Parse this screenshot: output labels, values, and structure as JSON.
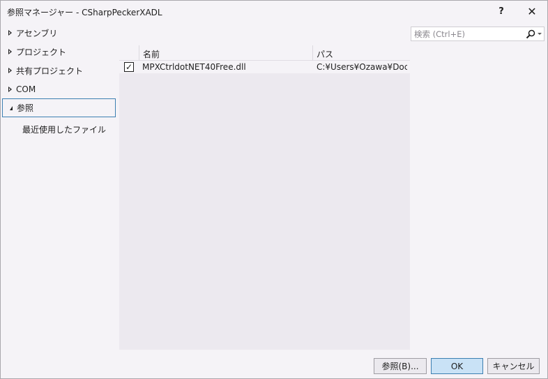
{
  "window": {
    "title": "参照マネージャー - CSharpPeckerXADL",
    "help_label": "?",
    "close_label": "✕"
  },
  "tree": {
    "items": [
      {
        "label": "アセンブリ",
        "expanded": false
      },
      {
        "label": "プロジェクト",
        "expanded": false
      },
      {
        "label": "共有プロジェクト",
        "expanded": false
      },
      {
        "label": "COM",
        "expanded": false
      },
      {
        "label": "参照",
        "expanded": true,
        "selected": true
      }
    ],
    "sub_items": [
      {
        "label": "最近使用したファイル"
      }
    ]
  },
  "list": {
    "columns": [
      "名前",
      "パス"
    ],
    "rows": [
      {
        "checked": true,
        "check_glyph": "✓",
        "name": "MPXCtrldotNET40Free.dll",
        "path": "C:¥Users¥Ozawa¥Docu..."
      }
    ]
  },
  "search": {
    "placeholder": "検索 (Ctrl+E)",
    "value": "",
    "icon": "search-icon"
  },
  "buttons": {
    "browse": "参照(B)...",
    "ok": "OK",
    "cancel": "キャンセル"
  },
  "colors": {
    "background": "#f5f3f7",
    "list_background": "#ece9ef",
    "selection_border": "#3c7fb1",
    "primary_button": "#c9e2f6"
  }
}
